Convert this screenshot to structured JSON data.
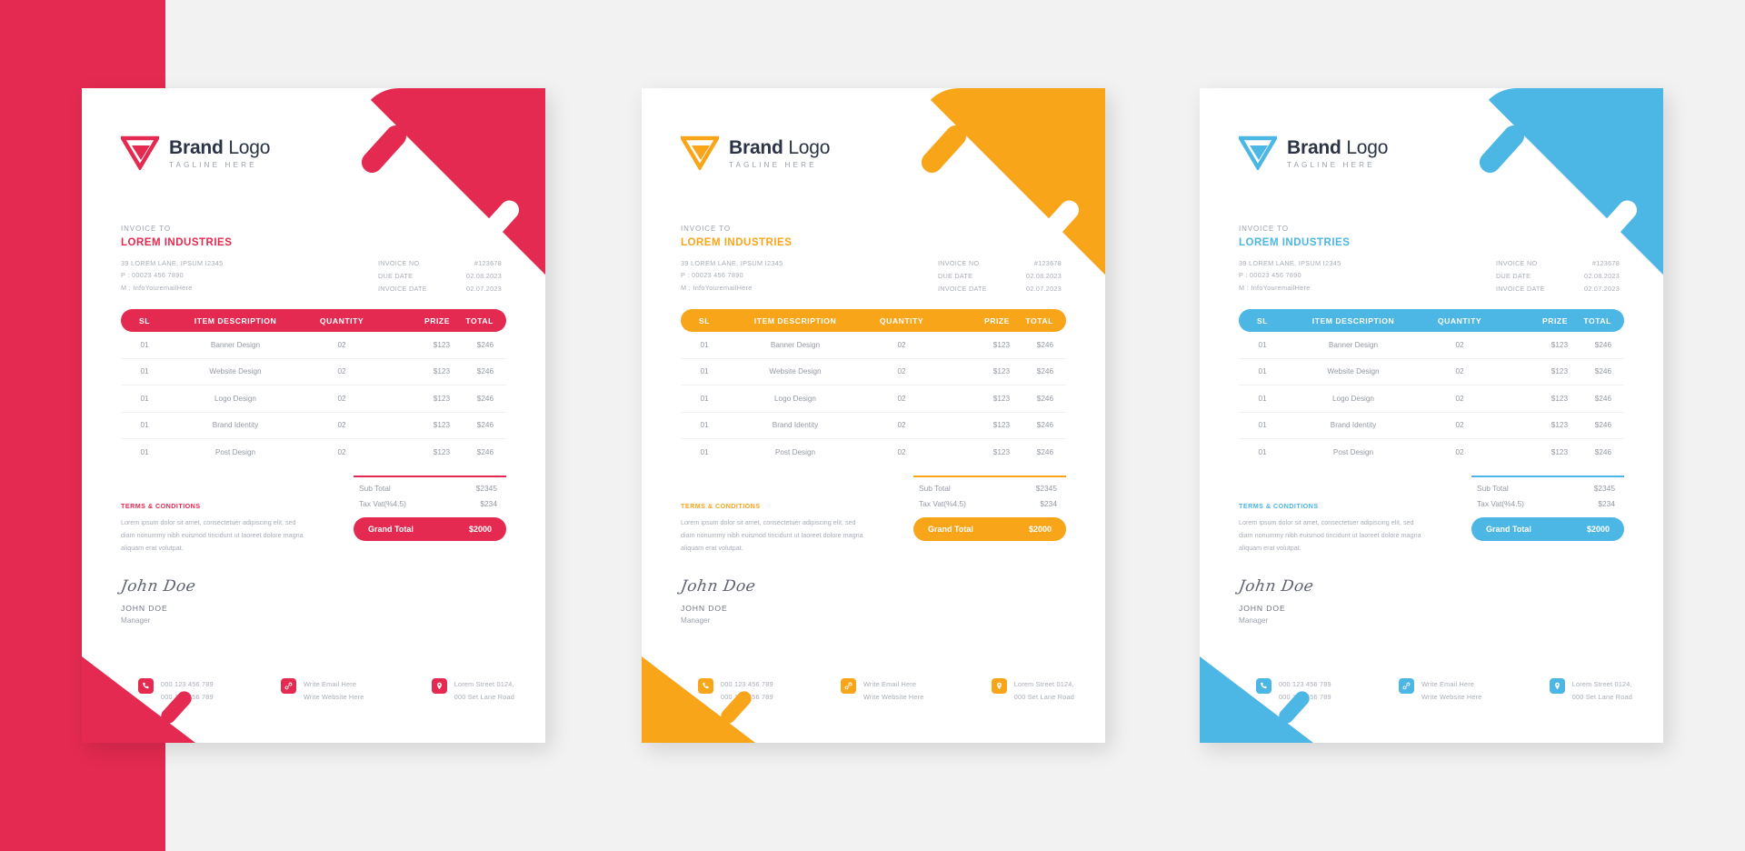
{
  "canvas": {
    "background": "#f2f2f2",
    "bleed_band_color": "#e42a50"
  },
  "logo": {
    "title_bold": "Brand",
    "title_light": " Logo",
    "tagline": "TAGLINE HERE",
    "mark_icon": "triangle-arrow-logo-icon"
  },
  "invoice_to": {
    "label": "INVOICE TO",
    "client": "LOREM INDUSTRIES",
    "address": "39 LOREM LANE, IPSUM I2345",
    "phone": "P : 00023 456 7890",
    "email": "M : InfoYouremailHere"
  },
  "meta": [
    {
      "key": "INVOICE NO",
      "value": "#123678"
    },
    {
      "key": "DUE DATE",
      "value": "02.08.2023"
    },
    {
      "key": "INVOICE DATE",
      "value": "02.07.2023"
    }
  ],
  "table": {
    "headers": [
      "SL",
      "ITEM DESCRIPTION",
      "QUANTITY",
      "PRIZE",
      "TOTAL"
    ],
    "rows": [
      {
        "sl": "01",
        "desc": "Banner Design",
        "qty": "02",
        "prize": "$123",
        "total": "$246"
      },
      {
        "sl": "01",
        "desc": "Website Design",
        "qty": "02",
        "prize": "$123",
        "total": "$246"
      },
      {
        "sl": "01",
        "desc": "Logo Design",
        "qty": "02",
        "prize": "$123",
        "total": "$246"
      },
      {
        "sl": "01",
        "desc": "Brand Identity",
        "qty": "02",
        "prize": "$123",
        "total": "$246"
      },
      {
        "sl": "01",
        "desc": "Post Design",
        "qty": "02",
        "prize": "$123",
        "total": "$246"
      }
    ]
  },
  "totals": {
    "sub_total_label": "Sub Total",
    "sub_total_value": "$2345",
    "tax_label": "Tax Vat(%4.5)",
    "tax_value": "$234",
    "grand_label": "Grand Total",
    "grand_value": "$2000"
  },
  "terms": {
    "title": "TERMS & CONDITIONS",
    "body": "Lorem ipsum dolor sit amet, consectetuer adipiscing elit, sed diam nonummy nibh euismod tincidunt ut laoreet dolore magna aliquam erat volutpat."
  },
  "signature": {
    "script": "John Doe",
    "name": "JOHN DOE",
    "role": "Manager"
  },
  "footer": {
    "phone": {
      "icon": "phone-icon",
      "line1": "000 123 456 789",
      "line2": "000 123 456 789"
    },
    "web": {
      "icon": "link-icon",
      "line1": "Write Email Here",
      "line2": "Write Website Here"
    },
    "addr": {
      "icon": "location-pin-icon",
      "line1": "Lorem Street 0124,",
      "line2": "000 Set Lane Road"
    }
  },
  "variants": [
    {
      "id": "s1",
      "accent": "#e42a50",
      "name": "red-invoice"
    },
    {
      "id": "s2",
      "accent": "#f9a51a",
      "name": "orange-invoice"
    },
    {
      "id": "s3",
      "accent": "#4cb6e5",
      "name": "blue-invoice"
    }
  ]
}
